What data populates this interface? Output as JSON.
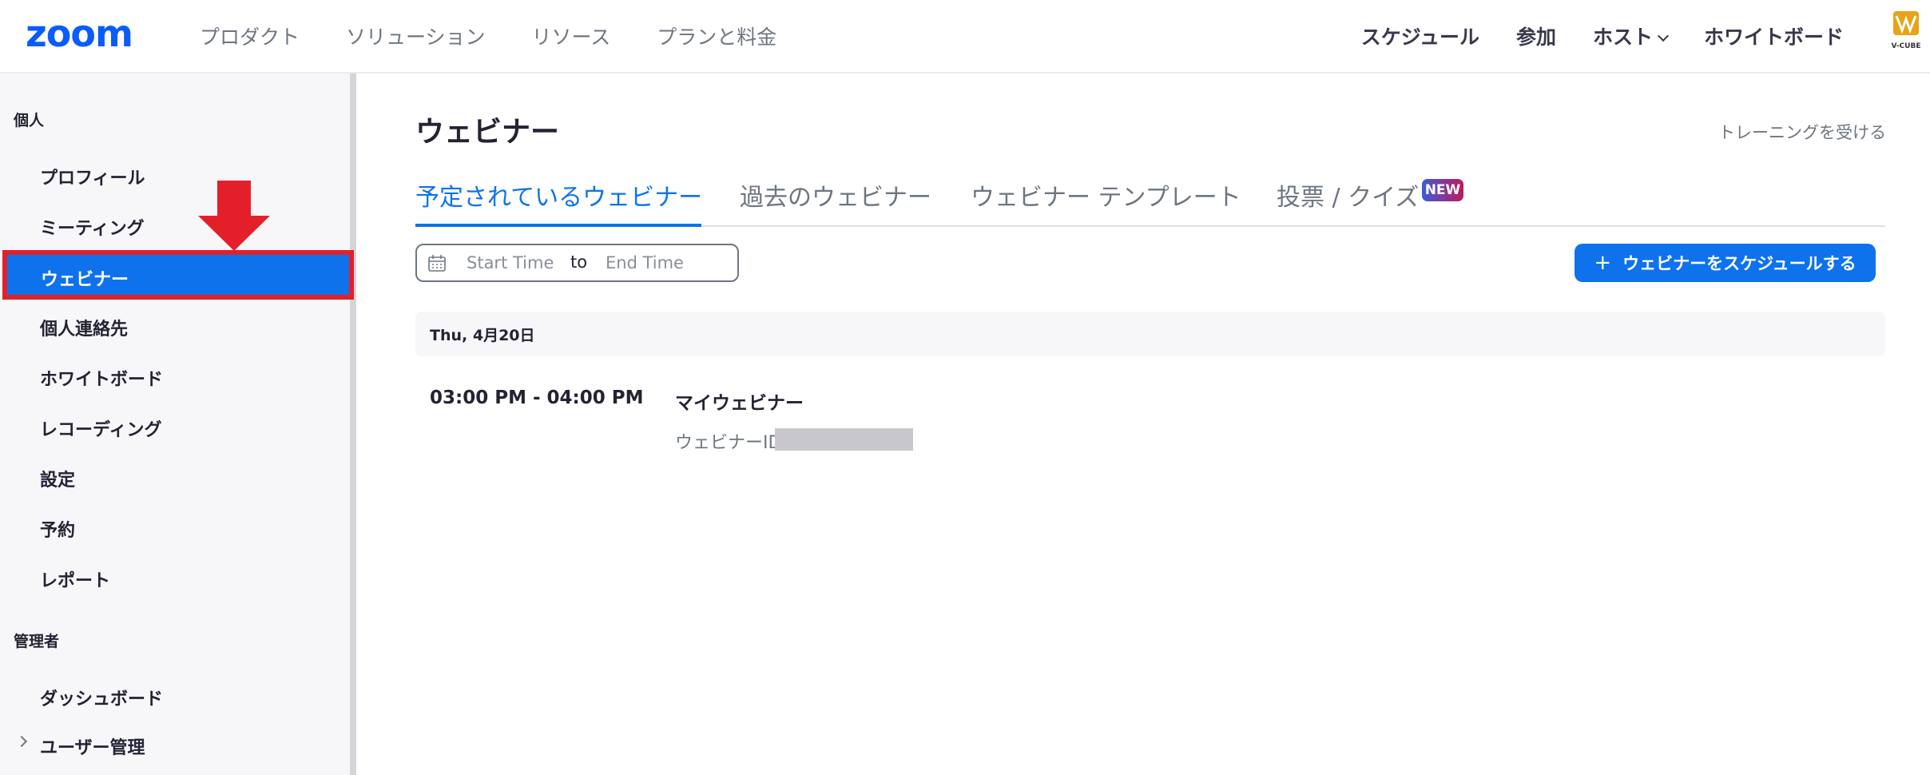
{
  "app": {
    "logo": "zoom",
    "partner_logo": "V-CUBE"
  },
  "topnav": {
    "left": [
      "プロダクト",
      "ソリューション",
      "リソース",
      "プランと料金"
    ],
    "right": {
      "schedule": "スケジュール",
      "join": "参加",
      "host": "ホスト",
      "whiteboard": "ホワイトボード"
    }
  },
  "sidebar": {
    "personal_label": "個人",
    "items": [
      {
        "label": "プロフィール"
      },
      {
        "label": "ミーティング"
      },
      {
        "label": "ウェビナー",
        "active": true
      },
      {
        "label": "個人連絡先"
      },
      {
        "label": "ホワイトボード"
      },
      {
        "label": "レコーディング"
      },
      {
        "label": "設定"
      },
      {
        "label": "予約"
      },
      {
        "label": "レポート"
      }
    ],
    "admin_label": "管理者",
    "admin_items": [
      {
        "label": "ダッシュボード"
      },
      {
        "label": "ユーザー管理",
        "expandable": true
      }
    ]
  },
  "main": {
    "title": "ウェビナー",
    "training_link": "トレーニングを受ける",
    "tabs": [
      {
        "label": "予定されているウェビナー",
        "active": true
      },
      {
        "label": "過去のウェビナー"
      },
      {
        "label": "ウェビナー テンプレート"
      },
      {
        "label": "投票 / クイズ",
        "badge": "NEW"
      }
    ],
    "date_range": {
      "start_placeholder": "Start Time",
      "separator": "to",
      "end_placeholder": "End Time"
    },
    "schedule_button": "ウェビナーをスケジュールする",
    "day_header": "Thu, 4月20日",
    "webinars": [
      {
        "time": "03:00 PM - 04:00 PM",
        "name": "マイウェビナー",
        "id_label": "ウェビナーID"
      }
    ]
  },
  "colors": {
    "accent": "#0e72ed",
    "highlight_border": "#e3202a",
    "arrow": "#e3202a"
  }
}
